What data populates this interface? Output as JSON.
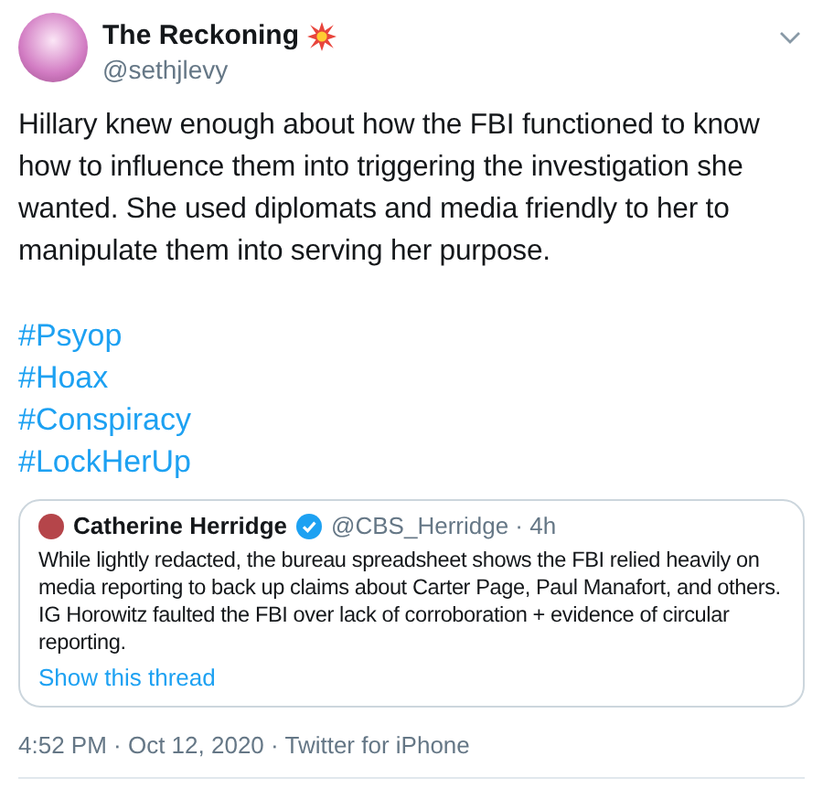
{
  "author": {
    "name": "The Reckoning",
    "handle": "@sethjlevy"
  },
  "text": "Hillary knew enough about how the FBI functioned to know how to influence them into triggering the investigation she wanted. She used diplomats and media friendly to her to manipulate them into serving her purpose.",
  "hashtags": [
    "#Psyop",
    "#Hoax",
    "#Conspiracy",
    "#LockHerUp"
  ],
  "quote": {
    "name": "Catherine Herridge",
    "verified": true,
    "meta": "@CBS_Herridge · 4h",
    "text": "While lightly redacted, the bureau spreadsheet shows the FBI relied heavily on media reporting to back up claims about Carter Page, Paul Manafort, and others.  IG Horowitz faulted the FBI over lack of corroboration + evidence of circular reporting.",
    "link": "Show this thread"
  },
  "footer": "4:52 PM · Oct 12, 2020 · Twitter for iPhone"
}
